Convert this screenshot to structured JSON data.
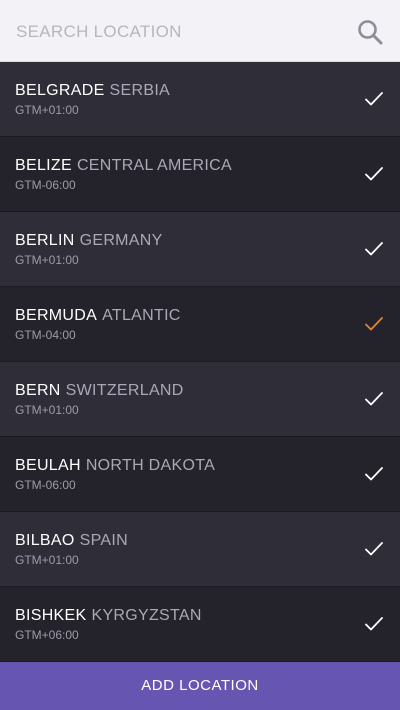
{
  "search": {
    "placeholder": "SEARCH LOCATION",
    "value": "",
    "icon": "search-icon"
  },
  "colors": {
    "accent": "#6756b1",
    "check_default": "#ffffff",
    "check_active": "#e0853a"
  },
  "locations": [
    {
      "city": "BELGRADE",
      "region": "SERBIA",
      "tz": "GTM+01:00",
      "active": false
    },
    {
      "city": "BELIZE",
      "region": "CENTRAL AMERICA",
      "tz": "GTM-06:00",
      "active": false
    },
    {
      "city": "BERLIN",
      "region": "GERMANY",
      "tz": "GTM+01:00",
      "active": false
    },
    {
      "city": "BERMUDA",
      "region": "ATLANTIC",
      "tz": "GTM-04:00",
      "active": true
    },
    {
      "city": "BERN",
      "region": "SWITZERLAND",
      "tz": "GTM+01:00",
      "active": false
    },
    {
      "city": "BEULAH",
      "region": "NORTH DAKOTA",
      "tz": "GTM-06:00",
      "active": false
    },
    {
      "city": "BILBAO",
      "region": "SPAIN",
      "tz": "GTM+01:00",
      "active": false
    },
    {
      "city": "BISHKEK",
      "region": "KYRGYZSTAN",
      "tz": "GTM+06:00",
      "active": false
    }
  ],
  "footer": {
    "add_label": "ADD LOCATION"
  }
}
